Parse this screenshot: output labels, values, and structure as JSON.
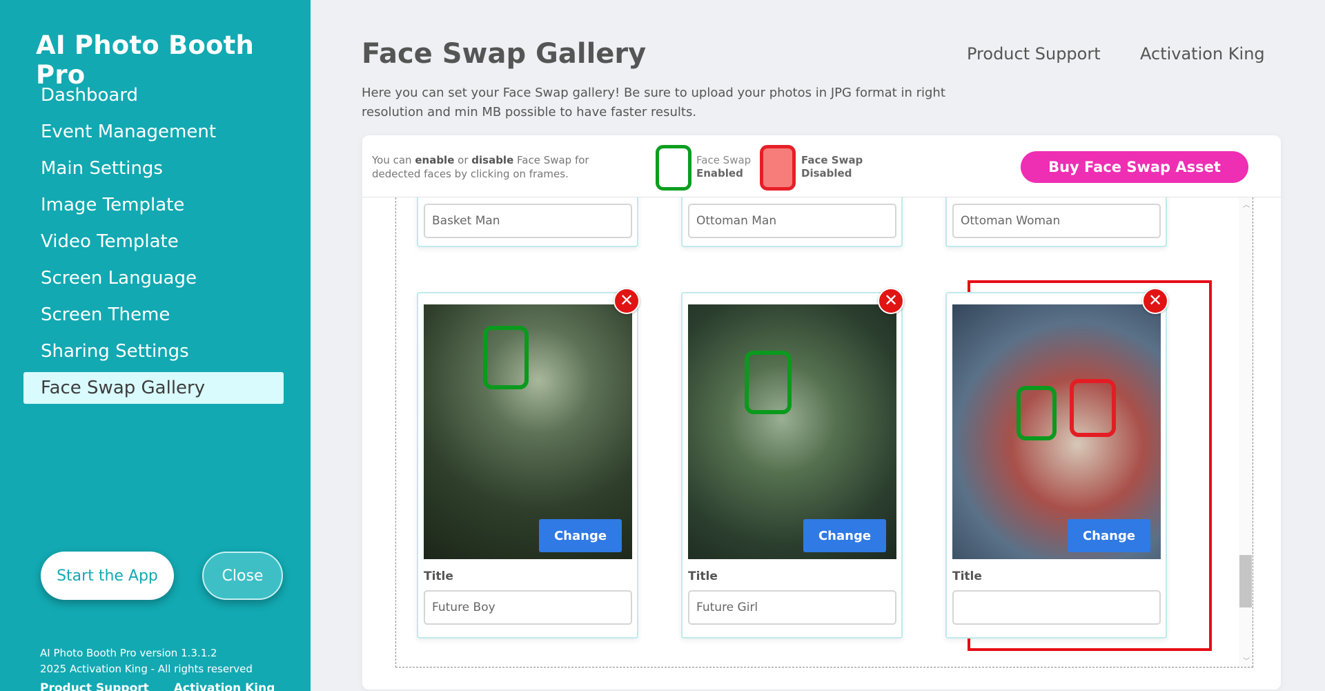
{
  "sidebar": {
    "app_title": "AI Photo Booth Pro",
    "items": [
      {
        "label": "Dashboard"
      },
      {
        "label": "Event Management"
      },
      {
        "label": "Main Settings"
      },
      {
        "label": "Image Template"
      },
      {
        "label": "Video Template"
      },
      {
        "label": "Screen Language"
      },
      {
        "label": "Screen Theme"
      },
      {
        "label": "Sharing Settings"
      },
      {
        "label": "Face Swap Gallery"
      }
    ],
    "start_label": "Start the App",
    "close_label": "Close",
    "version": "AI Photo Booth Pro version 1.3.1.2",
    "copyright": "2025 Activation King - All rights reserved",
    "footer_support": "Product Support",
    "footer_brand": "Activation King"
  },
  "header": {
    "title": "Face Swap Gallery",
    "support_link": "Product Support",
    "brand_link": "Activation King",
    "intro": "Here you can set your Face Swap gallery! Be sure to upload your photos in JPG format in right resolution and min MB possible to have faster results."
  },
  "toolbar": {
    "hint_p1": "You can ",
    "hint_enable": "enable",
    "hint_p2": " or ",
    "hint_disable": "disable",
    "hint_p3": " Face Swap for dedected faces by clicking on frames.",
    "enabled_line1": "Face Swap",
    "enabled_line2": "Enabled",
    "disabled_line1": "Face Swap",
    "disabled_line2": "Disabled",
    "buy_label": "Buy Face Swap Asset"
  },
  "gallery": {
    "top_row": [
      {
        "title": "Basket Man"
      },
      {
        "title": "Ottoman Man"
      },
      {
        "title": "Ottoman Woman"
      }
    ],
    "items": [
      {
        "title_label": "Title",
        "title": "Future Boy",
        "change_label": "Change"
      },
      {
        "title_label": "Title",
        "title": "Future Girl",
        "change_label": "Change"
      },
      {
        "title_label": "Title",
        "title": "",
        "change_label": "Change"
      }
    ]
  },
  "colors": {
    "sidebar": "#12a9b2",
    "enabled": "#0a9a1d",
    "disabled": "#e41d24",
    "buy": "#ee2eb3",
    "change": "#2f7ae5"
  }
}
